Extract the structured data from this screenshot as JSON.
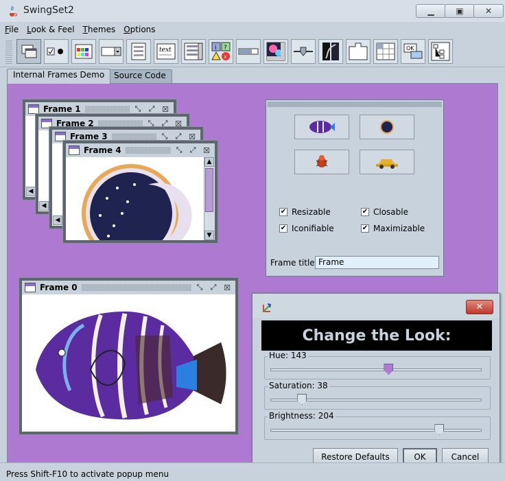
{
  "window": {
    "title": "SwingSet2"
  },
  "menus": [
    "File",
    "Look & Feel",
    "Themes",
    "Options"
  ],
  "toolbar": {
    "selected_index": 0,
    "count": 16
  },
  "tabs": {
    "active": "Internal Frames Demo",
    "other": "Source Code"
  },
  "frames": [
    {
      "title": "Frame 4"
    },
    {
      "title": "Frame 3"
    },
    {
      "title": "Frame 2"
    },
    {
      "title": "Frame 1"
    },
    {
      "title": "Frame 0"
    }
  ],
  "palette": {
    "checkboxes": [
      {
        "label": "Resizable",
        "checked": true
      },
      {
        "label": "Closable",
        "checked": true
      },
      {
        "label": "Iconifiable",
        "checked": true
      },
      {
        "label": "Maximizable",
        "checked": true
      }
    ],
    "frame_title_label": "Frame title:",
    "frame_title_value": "Frame"
  },
  "dialog": {
    "banner": "Change the Look:",
    "hue_label": "Hue: 143",
    "saturation_label": "Saturation: 38",
    "brightness_label": "Brightness: 204",
    "restore_label": "Restore Defaults",
    "ok_label": "OK",
    "cancel_label": "Cancel",
    "hue_fraction": 0.56,
    "saturation_fraction": 0.15,
    "brightness_fraction": 0.8
  },
  "status": "Press Shift-F10 to activate popup menu",
  "colors": {
    "desktop": "#ae7ad1",
    "accent": "#8a6bd1"
  }
}
